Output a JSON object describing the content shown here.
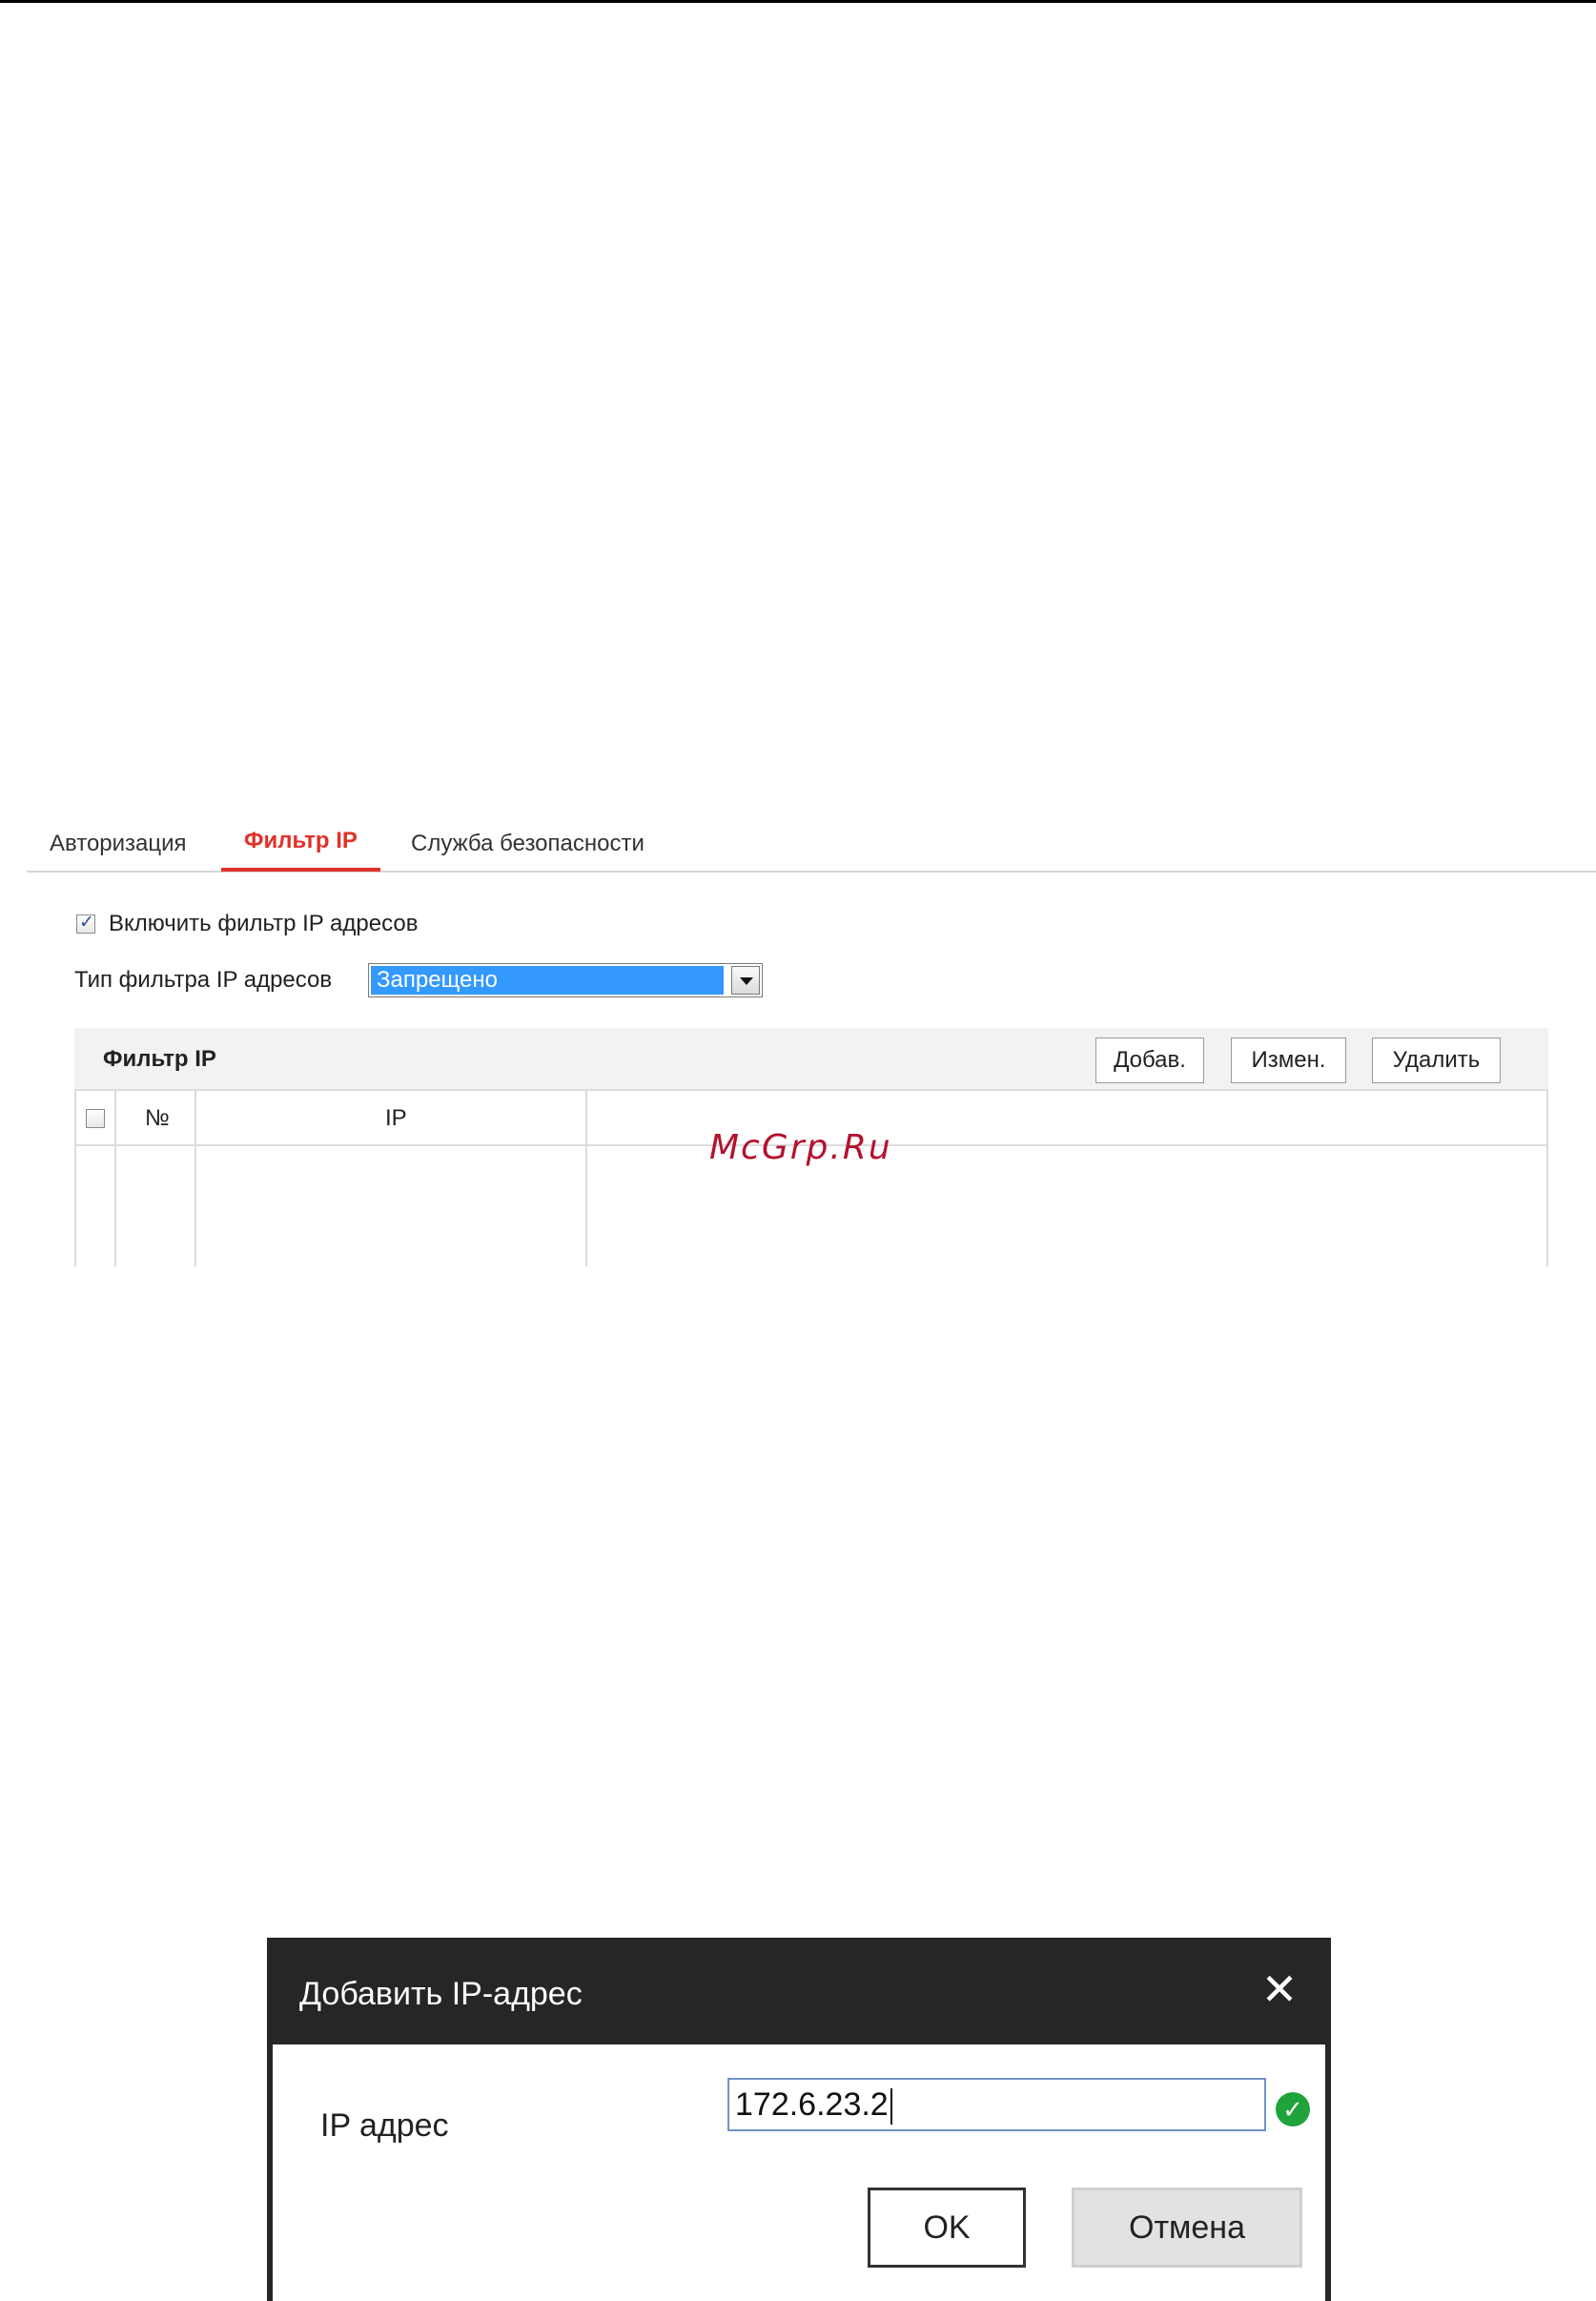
{
  "tabs": [
    {
      "label": "Авторизация"
    },
    {
      "label": "Фильтр IP",
      "active": true
    },
    {
      "label": "Служба безопасности"
    }
  ],
  "enable_filter": {
    "label": "Включить фильтр IP адресов",
    "checked": true
  },
  "filter_type": {
    "label": "Тип фильтра IP адресов",
    "selected": "Запрещено"
  },
  "filter_panel": {
    "title": "Фильтр IP",
    "buttons": {
      "add": "Добав.",
      "edit": "Измен.",
      "delete": "Удалить"
    },
    "columns": {
      "no": "№",
      "ip": "IP"
    },
    "rows": []
  },
  "watermark": "McGrp.Ru",
  "dialog": {
    "title": "Добавить IP-адрес",
    "field_label": "IP адрес",
    "ip_value": "172.6.23.2",
    "ok_label": "OK",
    "cancel_label": "Отмена"
  },
  "colors": {
    "accent": "#e0312a",
    "select_highlight": "#3399ff",
    "valid": "#1fa33a"
  }
}
